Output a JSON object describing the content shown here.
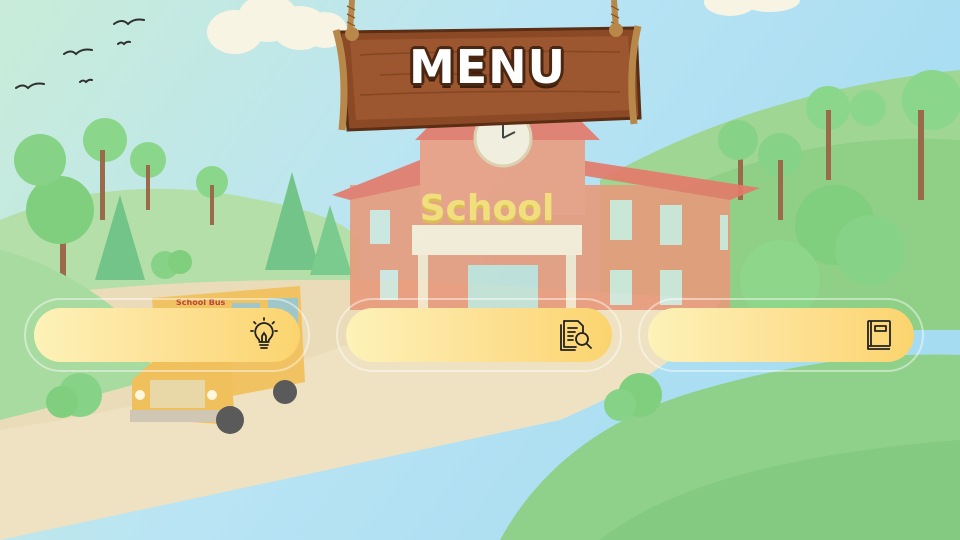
{
  "sign": {
    "title": "MENU"
  },
  "scene": {
    "building_sign": "School",
    "bus_sign": "School Bus"
  },
  "menu": {
    "buttons": [
      {
        "icon": "lightbulb-icon",
        "label": ""
      },
      {
        "icon": "document-search-icon",
        "label": ""
      },
      {
        "icon": "book-icon",
        "label": ""
      }
    ]
  },
  "colors": {
    "button_fill": "#fde39a",
    "sign_wood": "#8b4a25",
    "sky": "#bfe6f3",
    "grass": "#8fd08a",
    "path": "#efe2c2"
  }
}
